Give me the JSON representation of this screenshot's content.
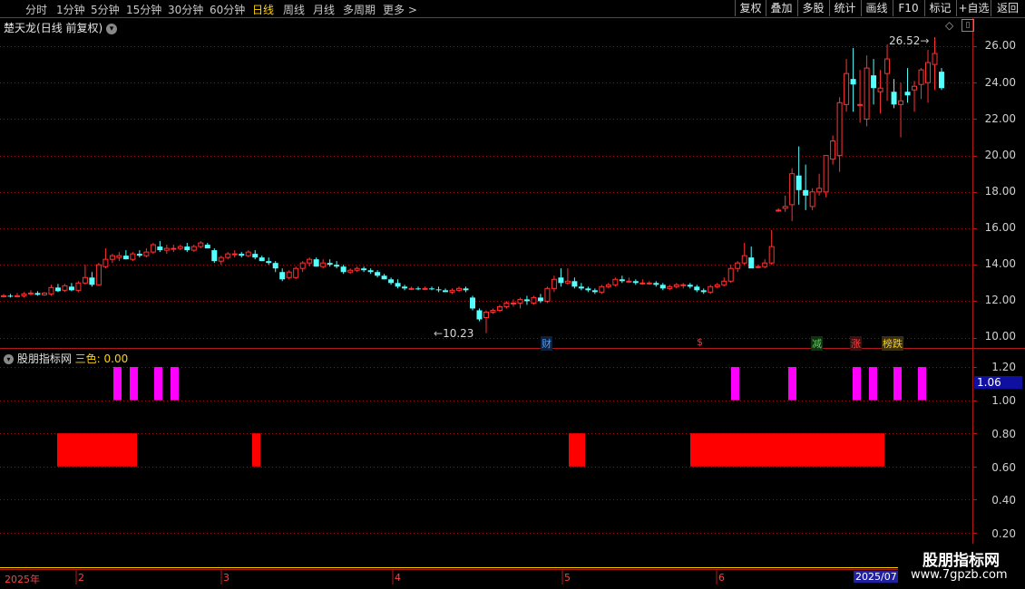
{
  "toolbar": {
    "periods": [
      "分时",
      "1分钟",
      "5分钟",
      "15分钟",
      "30分钟",
      "60分钟",
      "日线",
      "周线",
      "月线",
      "多周期",
      "更多 >"
    ],
    "active_period": "日线",
    "buttons": [
      "复权",
      "叠加",
      "多股",
      "统计",
      "画线",
      "F10",
      "标记",
      "+自选",
      "返回"
    ]
  },
  "main_chart": {
    "title": "楚天龙",
    "subtitle": "(日线 前复权)",
    "high_label": "26.52",
    "low_label": "10.23",
    "markers": [
      {
        "text": "财",
        "color": "#2b7bd5"
      },
      {
        "text": "$",
        "color": "#ff3030"
      },
      {
        "text": "减",
        "color": "#34b04a"
      },
      {
        "text": "涨",
        "color": "#ff3030"
      },
      {
        "text": "榜跌",
        "color": "#ffd200"
      }
    ],
    "y_ticks": [
      "26.00",
      "24.00",
      "22.00",
      "20.00",
      "18.00",
      "16.00",
      "14.00",
      "12.00",
      "10.00"
    ]
  },
  "indicator": {
    "name": "股朋指标网",
    "param_label": "三色:",
    "param_value": "0.00",
    "current_value_label": "1.06",
    "y_ticks": [
      "1.20",
      "1.00",
      "0.80",
      "0.60",
      "0.40",
      "0.20"
    ],
    "magenta_level": 1.0,
    "red_band": [
      0.6,
      0.8
    ]
  },
  "x_axis": {
    "labels": [
      "2025年",
      "2",
      "3",
      "4",
      "5",
      "6",
      "2025/07"
    ]
  },
  "watermark": {
    "line1": "股朋指标网",
    "line2": "www.7gpzb.com"
  },
  "colors": {
    "up": "#ff3232",
    "down": "#54ffff",
    "grid": "#8b1010",
    "magenta": "#ff00ff",
    "band": "#ff0000",
    "axis_text": "#d0d0d0"
  },
  "chart_data": {
    "type": "candlestick",
    "x_range": [
      "2025-01",
      "2025-07"
    ],
    "ylim": [
      10,
      27
    ],
    "ohlc": [
      [
        12.3,
        12.4,
        12.2,
        12.3
      ],
      [
        12.3,
        12.4,
        12.2,
        12.25
      ],
      [
        12.3,
        12.45,
        12.2,
        12.3
      ],
      [
        12.3,
        12.5,
        12.2,
        12.4
      ],
      [
        12.4,
        12.6,
        12.3,
        12.45
      ],
      [
        12.45,
        12.55,
        12.3,
        12.35
      ],
      [
        12.35,
        12.5,
        12.3,
        12.45
      ],
      [
        12.4,
        12.9,
        12.3,
        12.75
      ],
      [
        12.75,
        12.95,
        12.5,
        12.55
      ],
      [
        12.6,
        12.95,
        12.5,
        12.85
      ],
      [
        12.8,
        13.0,
        12.55,
        12.6
      ],
      [
        12.6,
        13.1,
        12.5,
        13.0
      ],
      [
        13.0,
        14.0,
        12.9,
        13.3
      ],
      [
        13.3,
        13.6,
        12.8,
        12.9
      ],
      [
        12.9,
        14.1,
        12.85,
        14.0
      ],
      [
        13.9,
        14.9,
        13.8,
        14.3
      ],
      [
        14.3,
        14.6,
        14.1,
        14.5
      ],
      [
        14.4,
        14.7,
        14.2,
        14.5
      ],
      [
        14.5,
        14.8,
        14.3,
        14.3
      ],
      [
        14.3,
        14.7,
        14.2,
        14.6
      ],
      [
        14.6,
        14.8,
        14.4,
        14.5
      ],
      [
        14.5,
        14.9,
        14.4,
        14.7
      ],
      [
        14.7,
        15.2,
        14.6,
        15.1
      ],
      [
        15.0,
        15.3,
        14.7,
        14.8
      ],
      [
        14.8,
        15.1,
        14.6,
        14.9
      ],
      [
        14.9,
        15.1,
        14.7,
        14.9
      ],
      [
        14.9,
        15.1,
        14.8,
        15.0
      ],
      [
        15.0,
        15.2,
        14.7,
        14.8
      ],
      [
        14.8,
        15.1,
        14.7,
        15.0
      ],
      [
        15.0,
        15.3,
        14.9,
        15.2
      ],
      [
        15.1,
        15.2,
        14.9,
        14.9
      ],
      [
        14.8,
        14.9,
        14.1,
        14.2
      ],
      [
        14.2,
        14.5,
        14.0,
        14.4
      ],
      [
        14.4,
        14.7,
        14.3,
        14.6
      ],
      [
        14.6,
        14.8,
        14.4,
        14.6
      ],
      [
        14.6,
        14.7,
        14.4,
        14.5
      ],
      [
        14.5,
        14.8,
        14.4,
        14.7
      ],
      [
        14.6,
        14.8,
        14.3,
        14.4
      ],
      [
        14.4,
        14.5,
        14.2,
        14.2
      ],
      [
        14.2,
        14.4,
        14.0,
        14.1
      ],
      [
        14.1,
        14.2,
        13.6,
        13.8
      ],
      [
        13.6,
        13.8,
        13.1,
        13.2
      ],
      [
        13.3,
        13.7,
        13.2,
        13.6
      ],
      [
        13.3,
        13.9,
        13.2,
        13.8
      ],
      [
        13.8,
        14.2,
        13.6,
        14.1
      ],
      [
        14.1,
        14.4,
        13.9,
        14.3
      ],
      [
        14.3,
        14.4,
        13.9,
        13.9
      ],
      [
        13.9,
        14.3,
        13.8,
        14.1
      ],
      [
        14.1,
        14.3,
        13.9,
        14.0
      ],
      [
        14.0,
        14.2,
        13.8,
        13.9
      ],
      [
        13.9,
        14.0,
        13.5,
        13.6
      ],
      [
        13.6,
        13.8,
        13.5,
        13.7
      ],
      [
        13.7,
        13.9,
        13.6,
        13.8
      ],
      [
        13.8,
        13.9,
        13.6,
        13.7
      ],
      [
        13.7,
        13.8,
        13.5,
        13.6
      ],
      [
        13.6,
        13.7,
        13.3,
        13.4
      ],
      [
        13.4,
        13.5,
        13.2,
        13.2
      ],
      [
        13.2,
        13.3,
        12.9,
        13.0
      ],
      [
        13.0,
        13.2,
        12.7,
        12.8
      ],
      [
        12.8,
        12.9,
        12.6,
        12.7
      ],
      [
        12.7,
        12.8,
        12.6,
        12.7
      ],
      [
        12.7,
        12.8,
        12.6,
        12.65
      ],
      [
        12.65,
        12.8,
        12.6,
        12.7
      ],
      [
        12.7,
        12.8,
        12.6,
        12.65
      ],
      [
        12.65,
        12.8,
        12.5,
        12.6
      ],
      [
        12.6,
        12.7,
        12.5,
        12.5
      ],
      [
        12.5,
        12.7,
        12.4,
        12.6
      ],
      [
        12.6,
        12.8,
        12.5,
        12.7
      ],
      [
        12.7,
        12.8,
        12.5,
        12.6
      ],
      [
        12.2,
        12.3,
        11.5,
        11.6
      ],
      [
        11.5,
        11.6,
        10.9,
        11.0
      ],
      [
        11.1,
        11.5,
        10.25,
        11.4
      ],
      [
        11.4,
        11.6,
        11.3,
        11.5
      ],
      [
        11.5,
        11.8,
        11.4,
        11.7
      ],
      [
        11.7,
        12.0,
        11.6,
        11.9
      ],
      [
        11.9,
        12.1,
        11.7,
        11.9
      ],
      [
        11.9,
        12.2,
        11.6,
        12.1
      ],
      [
        12.1,
        12.3,
        11.8,
        12.0
      ],
      [
        11.9,
        12.3,
        11.8,
        12.2
      ],
      [
        12.2,
        12.4,
        11.9,
        12.0
      ],
      [
        12.0,
        12.8,
        11.9,
        12.7
      ],
      [
        12.7,
        13.4,
        12.5,
        13.2
      ],
      [
        13.3,
        13.8,
        12.8,
        13.0
      ],
      [
        13.0,
        13.8,
        12.9,
        13.1
      ],
      [
        13.1,
        13.3,
        12.7,
        12.8
      ],
      [
        12.8,
        13.0,
        12.6,
        12.7
      ],
      [
        12.7,
        12.8,
        12.5,
        12.6
      ],
      [
        12.6,
        12.7,
        12.4,
        12.5
      ],
      [
        12.5,
        12.9,
        12.4,
        12.8
      ],
      [
        12.8,
        13.0,
        12.7,
        12.9
      ],
      [
        12.9,
        13.3,
        12.8,
        13.2
      ],
      [
        13.2,
        13.4,
        13.0,
        13.1
      ],
      [
        13.1,
        13.3,
        13.0,
        13.1
      ],
      [
        13.1,
        13.2,
        12.9,
        13.0
      ],
      [
        13.0,
        13.2,
        12.9,
        13.0
      ],
      [
        13.0,
        13.1,
        12.9,
        13.0
      ],
      [
        13.0,
        13.1,
        12.8,
        12.9
      ],
      [
        12.9,
        13.0,
        12.6,
        12.7
      ],
      [
        12.7,
        12.9,
        12.6,
        12.8
      ],
      [
        12.8,
        13.0,
        12.7,
        12.9
      ],
      [
        12.9,
        13.0,
        12.7,
        12.9
      ],
      [
        12.9,
        13.0,
        12.7,
        12.8
      ],
      [
        12.8,
        12.9,
        12.5,
        12.6
      ],
      [
        12.6,
        12.7,
        12.4,
        12.5
      ],
      [
        12.5,
        12.9,
        12.4,
        12.8
      ],
      [
        12.8,
        13.0,
        12.7,
        12.9
      ],
      [
        12.9,
        13.3,
        12.8,
        13.1
      ],
      [
        13.1,
        14.0,
        13.0,
        13.8
      ],
      [
        13.8,
        14.2,
        13.6,
        14.1
      ],
      [
        14.1,
        15.2,
        14.0,
        14.5
      ],
      [
        14.4,
        15.0,
        14.3,
        13.8
      ],
      [
        13.9,
        14.0,
        13.8,
        13.9
      ],
      [
        13.9,
        14.3,
        13.8,
        14.1
      ],
      [
        14.1,
        15.9,
        14.0,
        15.0
      ],
      [
        17.0,
        17.1,
        16.9,
        17.0
      ],
      [
        17.1,
        17.8,
        16.9,
        17.2
      ],
      [
        17.3,
        19.3,
        16.4,
        19.0
      ],
      [
        18.9,
        20.5,
        17.3,
        18.1
      ],
      [
        18.1,
        19.5,
        17.0,
        17.8
      ],
      [
        17.2,
        18.2,
        17.0,
        18.0
      ],
      [
        18.0,
        19.0,
        17.8,
        18.2
      ],
      [
        18.0,
        20.0,
        17.7,
        20.0
      ],
      [
        19.8,
        21.1,
        19.5,
        20.8
      ],
      [
        20.0,
        23.2,
        19.1,
        22.9
      ],
      [
        22.8,
        25.3,
        22.4,
        24.5
      ],
      [
        24.2,
        25.9,
        22.4,
        23.9
      ],
      [
        22.8,
        24.7,
        21.8,
        22.8
      ],
      [
        22.0,
        25.5,
        21.6,
        24.8
      ],
      [
        24.4,
        25.3,
        22.8,
        23.7
      ],
      [
        23.5,
        24.7,
        22.3,
        23.7
      ],
      [
        24.5,
        26.1,
        23.0,
        25.3
      ],
      [
        23.5,
        24.2,
        22.6,
        22.8
      ],
      [
        22.8,
        24.0,
        21.0,
        23.0
      ],
      [
        23.5,
        24.8,
        22.9,
        23.3
      ],
      [
        23.6,
        24.1,
        22.4,
        23.8
      ],
      [
        23.9,
        24.8,
        23.1,
        24.7
      ],
      [
        24.0,
        25.8,
        22.9,
        25.1
      ],
      [
        25.0,
        26.5,
        23.6,
        25.6
      ],
      [
        24.6,
        24.8,
        23.6,
        23.7
      ]
    ],
    "signal_a": [
      false,
      false,
      false,
      false,
      false,
      false,
      false,
      false,
      false,
      false,
      false,
      false,
      false,
      false,
      false,
      false,
      false,
      false,
      false,
      false,
      false,
      false,
      true,
      false,
      false,
      false,
      false,
      false,
      false,
      false,
      false,
      false,
      false,
      false,
      false,
      false,
      false,
      false,
      false,
      false,
      false,
      false,
      false,
      false,
      false,
      false,
      false,
      false,
      false,
      false,
      false,
      false,
      false,
      false,
      false,
      false,
      false,
      false,
      false,
      false,
      false,
      false,
      false,
      false,
      false,
      false,
      false,
      false,
      false,
      false,
      false,
      false,
      false,
      false,
      false,
      false,
      false,
      false,
      false,
      false,
      false,
      false,
      false,
      false,
      false,
      false,
      false,
      false,
      false,
      false,
      false,
      false,
      false,
      false,
      false,
      false,
      false,
      false,
      false,
      false,
      false,
      false,
      false,
      false,
      false,
      false,
      false,
      false,
      false,
      false,
      false,
      false,
      false,
      false,
      false,
      false,
      false,
      false,
      false,
      false,
      false,
      false,
      false,
      false,
      false,
      false,
      false,
      false,
      false,
      false,
      false,
      false,
      false,
      false,
      false,
      false,
      false,
      false,
      false,
      false
    ],
    "signal_b": [
      false,
      false,
      false,
      false,
      false,
      false,
      false,
      false,
      false,
      false,
      false,
      false,
      false,
      false,
      false,
      false,
      false,
      false,
      false,
      false,
      false,
      false,
      false,
      false,
      false,
      false,
      false,
      false,
      false,
      false,
      false,
      false,
      false,
      false,
      false,
      false,
      false,
      false,
      false,
      false,
      false,
      false,
      false,
      false,
      false,
      false,
      false,
      false,
      false,
      false,
      false,
      false,
      false,
      false,
      false,
      false,
      false,
      false,
      false,
      false,
      false,
      false,
      false,
      false,
      false,
      false,
      false,
      false,
      false,
      false,
      false,
      false,
      false,
      false,
      false,
      false,
      false,
      false,
      false,
      false,
      false,
      false,
      false,
      false,
      false,
      false,
      false,
      false,
      false,
      false,
      false,
      false,
      false,
      false,
      false,
      false,
      false,
      false,
      false,
      false,
      false,
      false,
      false,
      false,
      false,
      false,
      false,
      false,
      false,
      false,
      false,
      false,
      false,
      false,
      false,
      false,
      false,
      false,
      false,
      false,
      false,
      false,
      false,
      false,
      false,
      false,
      false,
      false,
      false,
      false,
      false,
      false,
      false,
      false,
      false,
      false,
      false,
      false,
      false,
      false
    ]
  }
}
